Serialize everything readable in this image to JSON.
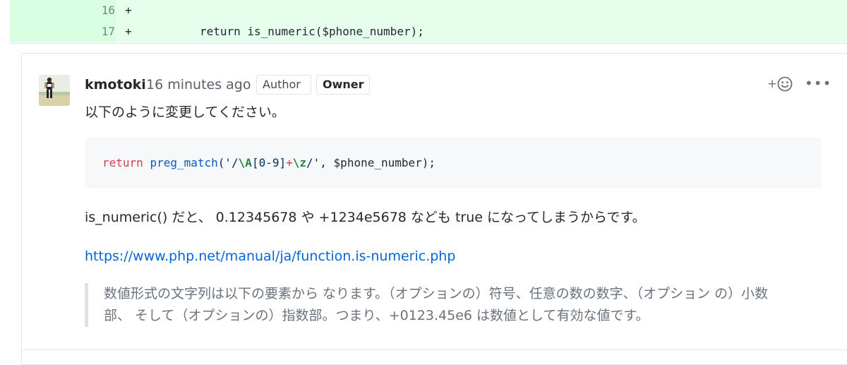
{
  "diff": {
    "lines": [
      {
        "number": "16",
        "code": "+"
      },
      {
        "number": "17",
        "code": "+          return is_numeric($phone_number);"
      }
    ]
  },
  "comment": {
    "author": "kmotoki",
    "timestamp": "16 minutes ago",
    "badges": {
      "author": "Author",
      "owner": "Owner"
    },
    "reaction_plus": "+",
    "more_label": "•••",
    "intro": "以下のように変更してください。",
    "code": {
      "t1": "return",
      "t2": " ",
      "t3": "preg_match",
      "t4": "(",
      "t5": "'/",
      "t6": "\\A",
      "t7": "[0-9]",
      "t8": "+",
      "t9": "\\z",
      "t10": "/'",
      "t11": ", $phone_number);"
    },
    "explanation": "is_numeric() だと、 0.12345678 や +1234e5678 なども true になってしまうからです。",
    "link": "https://www.php.net/manual/ja/function.is-numeric.php",
    "quote": "数値形式の文字列は以下の要素から なります。（オプションの）符号、任意の数の数字、（オプション の）小数部、 そして（オプションの）指数部。つまり、+0123.45e6 は数値として有効な値です。"
  },
  "colors": {
    "addition_bg": "#e6ffed",
    "addition_num_bg": "#cdffd8",
    "link": "#0366d6",
    "keyword": "#d73a49",
    "function": "#005cc5"
  },
  "icons": {
    "avatar": "user-avatar-runner",
    "reaction": "smiley-icon",
    "more": "kebab-icon"
  }
}
